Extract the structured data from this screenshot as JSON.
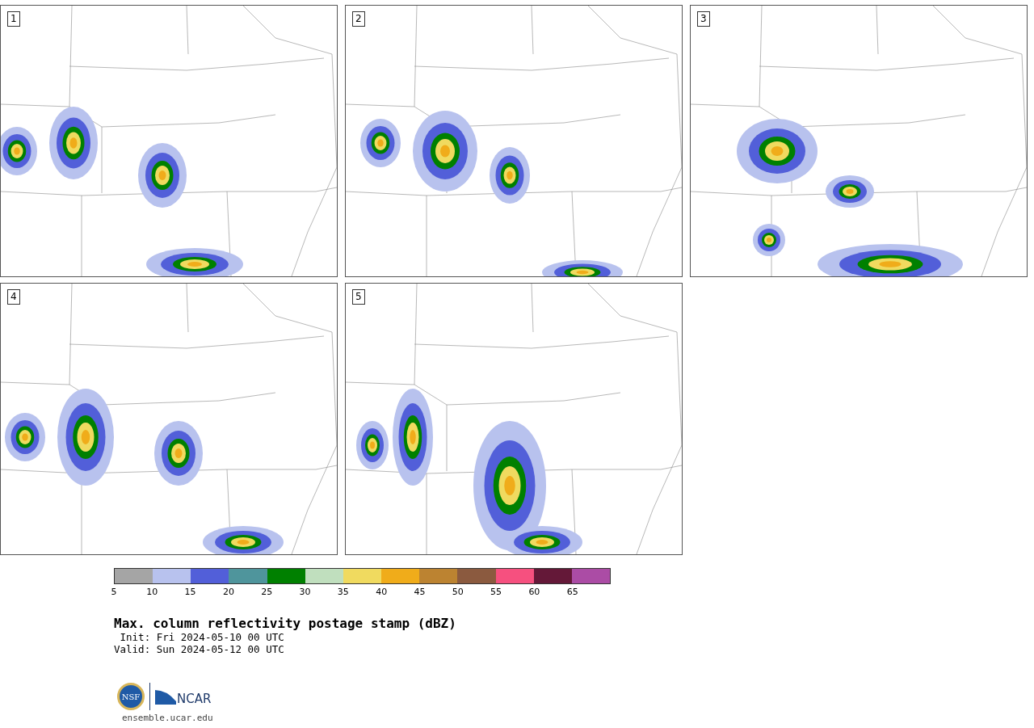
{
  "panels": [
    {
      "label": "1"
    },
    {
      "label": "2"
    },
    {
      "label": "3"
    },
    {
      "label": "4"
    },
    {
      "label": "5"
    }
  ],
  "colorbar": {
    "bins": [
      {
        "color": "#a5a5a5"
      },
      {
        "color": "#b8c2ee"
      },
      {
        "color": "#525fd9"
      },
      {
        "color": "#4f959c"
      },
      {
        "color": "#008000"
      },
      {
        "color": "#c0dfbe"
      },
      {
        "color": "#f0da5f"
      },
      {
        "color": "#f0ac1a"
      },
      {
        "color": "#bc8331"
      },
      {
        "color": "#8b5a3f"
      },
      {
        "color": "#f6507f"
      },
      {
        "color": "#641838"
      },
      {
        "color": "#ab4ca5"
      }
    ],
    "ticks": [
      "5",
      "10",
      "15",
      "20",
      "25",
      "30",
      "35",
      "40",
      "45",
      "50",
      "55",
      "60",
      "65"
    ]
  },
  "title": "Max. column reflectivity postage stamp (dBZ)",
  "init": " Init: Fri 2024-05-10 00 UTC",
  "valid": "Valid: Sun 2024-05-12 00 UTC",
  "logos": {
    "nsf": "NSF",
    "ncar": "NCAR"
  },
  "footer": "ensemble.ucar.edu"
}
